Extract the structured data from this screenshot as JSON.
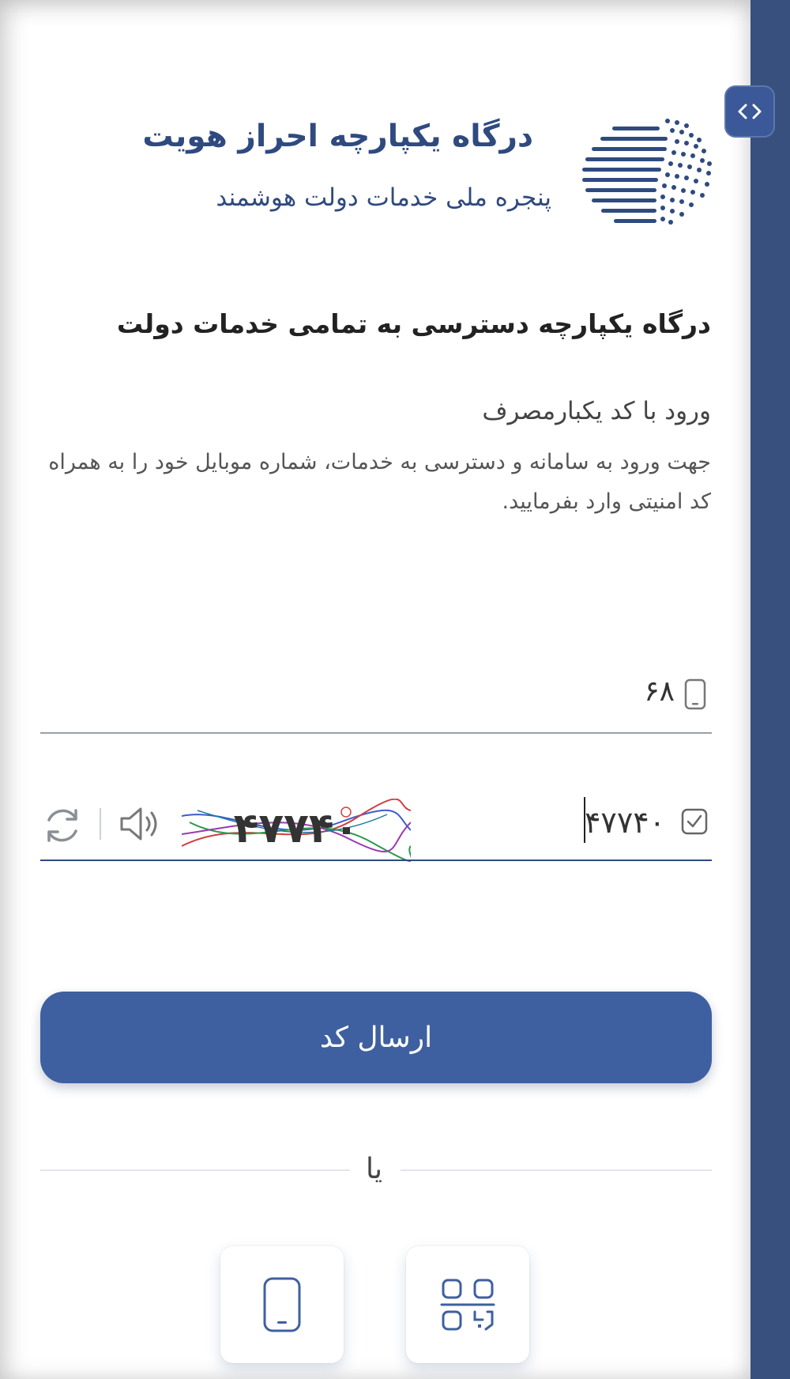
{
  "colors": {
    "brand": "#2f4a7f",
    "accent": "#3f60a0",
    "sidebar": "#37507e"
  },
  "header": {
    "title": "درگاه یکپارچه احراز هویت",
    "subtitle": "پنجره ملی خدمات دولت هوشمند",
    "logo_icon": "globe-lines-logo"
  },
  "main": {
    "heading": "درگاه یکپارچه دسترسی به تمامی خدمات دولت",
    "otp_title": "ورود با کد یکبارمصرف",
    "otp_description": "جهت ورود به سامانه و دسترسی به خدمات، شماره موبایل خود را به همراه کد امنیتی وارد بفرمایید."
  },
  "form": {
    "phone": {
      "value": "۶۸",
      "icon": "mobile-icon"
    },
    "captcha": {
      "value": "۴۷۷۴۰",
      "image_text": "۴۷۷۴۰",
      "icon": "check-square-icon",
      "refresh_icon": "refresh-icon",
      "audio_icon": "speaker-icon"
    },
    "submit_label": "ارسال کد"
  },
  "alternatives": {
    "or_label": "یا",
    "buttons": [
      {
        "icon": "qr-code-icon"
      },
      {
        "icon": "mobile-icon"
      }
    ]
  },
  "sidebar": {
    "toggle_icon": "code-brackets-icon"
  }
}
